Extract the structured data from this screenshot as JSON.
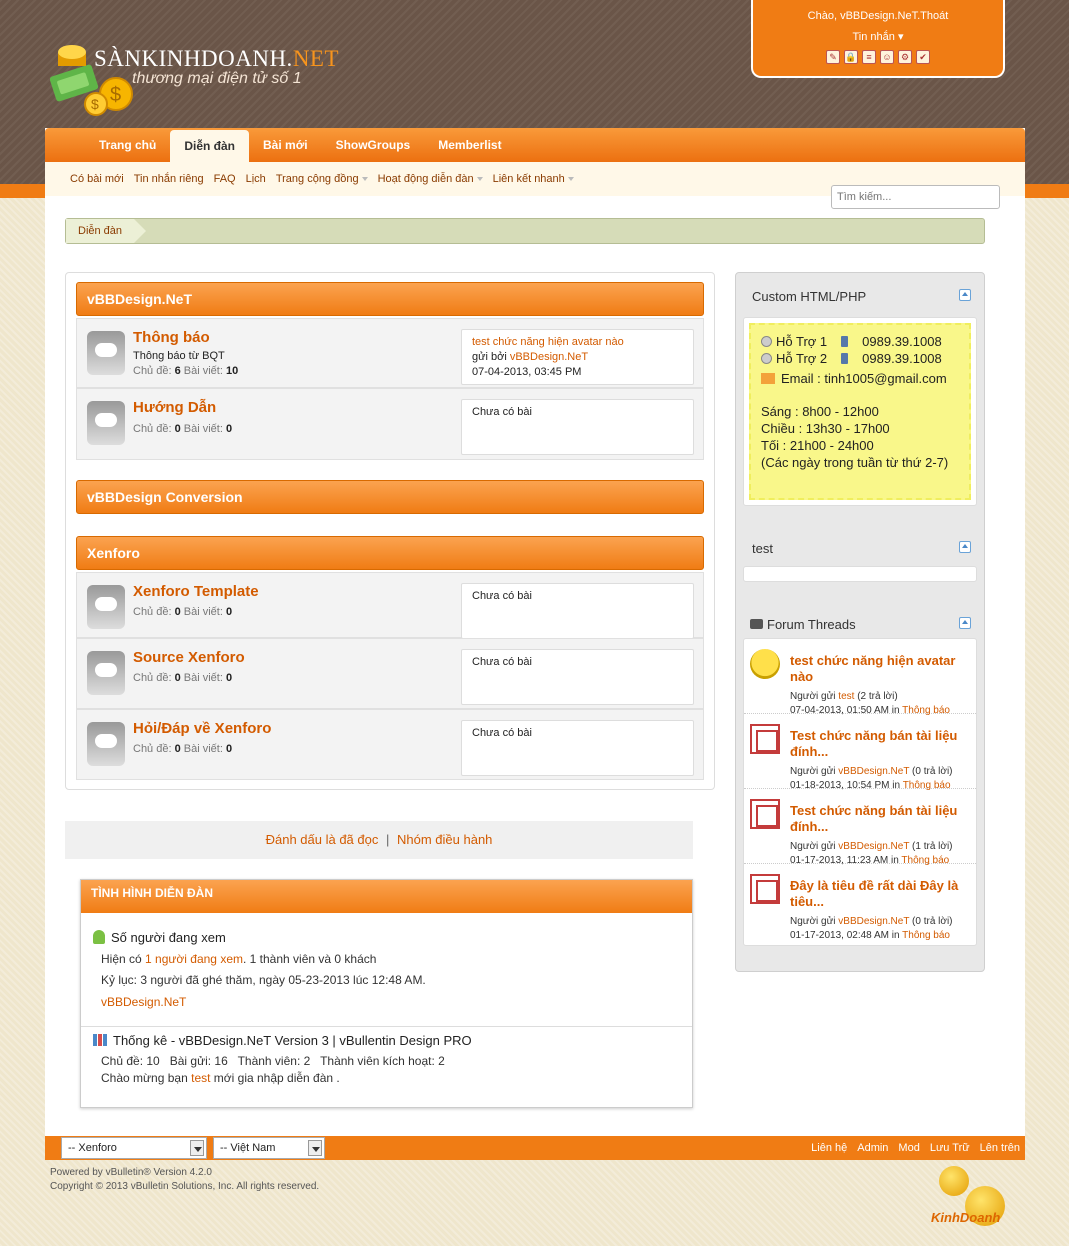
{
  "header": {
    "logo_title_main": "SÀNKINHDOANH.",
    "logo_title_net": "NET",
    "logo_slogan": "thương mại điện tử số 1",
    "greeting": "Chào, vBBDesign.NeT.Thoát",
    "private_messages": "Tin nhắn",
    "icon_names": [
      "edit-icon",
      "lock-icon",
      "document-icon",
      "users-icon",
      "settings-icon",
      "tools-icon"
    ]
  },
  "navbar": {
    "tabs": [
      "Trang chủ",
      "Diễn đàn",
      "Bài mới",
      "ShowGroups",
      "Memberlist"
    ],
    "active_tab": "Diễn đàn"
  },
  "subnav": [
    "Có bài mới",
    "Tin nhắn riêng",
    "FAQ",
    "Lịch",
    "Trang cộng đồng",
    "Hoạt động diễn đàn",
    "Liên kết nhanh"
  ],
  "search": {
    "placeholder": "Tìm kiếm..."
  },
  "breadcrumb": "Diễn đàn",
  "categories": [
    {
      "name": "vBBDesign.NeT",
      "forums": [
        {
          "name": "Thông báo",
          "desc": "Thông báo từ BQT",
          "stats_label_topics": "Chủ đề:",
          "topics": "6",
          "stats_label_posts": "Bài viết:",
          "posts": "10",
          "last_title": "test chức năng hiện avatar nào",
          "last_by_label": "gửi bởi",
          "last_by": "vBBDesign.NeT",
          "last_date": "07-04-2013, 03:45 PM"
        },
        {
          "name": "Hướng Dẫn",
          "desc": "",
          "stats_label_topics": "Chủ đề:",
          "topics": "0",
          "stats_label_posts": "Bài viết:",
          "posts": "0",
          "empty": "Chưa có bài"
        }
      ]
    },
    {
      "name": "vBBDesign Conversion",
      "forums": []
    },
    {
      "name": "Xenforo",
      "forums": [
        {
          "name": "Xenforo Template",
          "stats_label_topics": "Chủ đề:",
          "topics": "0",
          "stats_label_posts": "Bài viết:",
          "posts": "0",
          "empty": "Chưa có bài"
        },
        {
          "name": "Source Xenforo",
          "stats_label_topics": "Chủ đề:",
          "topics": "0",
          "stats_label_posts": "Bài viết:",
          "posts": "0",
          "empty": "Chưa có bài"
        },
        {
          "name": "Hỏi/Đáp về Xenforo",
          "stats_label_topics": "Chủ đề:",
          "topics": "0",
          "stats_label_posts": "Bài viết:",
          "posts": "0",
          "empty": "Chưa có bài"
        }
      ]
    }
  ],
  "sidebar": {
    "custom_title": "Custom HTML/PHP",
    "support": {
      "sup1": "Hỗ Trợ 1",
      "phone1": "0989.39.1008",
      "sup2": "Hỗ Trợ 2",
      "phone2": "0989.39.1008",
      "email": "Email : tinh1005@gmail.com",
      "hours": [
        "Sáng : 8h00 - 12h00",
        "Chiều : 13h30 - 17h00",
        "Tối : 21h00 - 24h00",
        "(Các ngày trong tuần từ thứ 2-7)"
      ]
    },
    "test_title": "test",
    "threads_title": "Forum Threads",
    "threads": [
      {
        "title": "test chức năng hiện avatar nào",
        "by_label": "Người gửi",
        "by": "test",
        "replies": "(2 trả lời)",
        "date": "07-04-2013, 01:50 AM",
        "in": "in",
        "forum": "Thông báo",
        "avatar": "smile"
      },
      {
        "title": "Test chức năng bán tài liệu đính...",
        "by_label": "Người gửi",
        "by": "vBBDesign.NeT",
        "replies": "(0 trả lời)",
        "date": "01-18-2013, 10:54 PM",
        "in": "in",
        "forum": "Thông báo",
        "avatar": "seal"
      },
      {
        "title": "Test chức năng bán tài liệu đính...",
        "by_label": "Người gửi",
        "by": "vBBDesign.NeT",
        "replies": "(1 trả lời)",
        "date": "01-17-2013, 11:23 AM",
        "in": "in",
        "forum": "Thông báo",
        "avatar": "seal"
      },
      {
        "title": "Đây là tiêu đề rất dài Đây là tiêu...",
        "by_label": "Người gửi",
        "by": "vBBDesign.NeT",
        "replies": "(0 trả lời)",
        "date": "01-17-2013, 02:48 AM",
        "in": "in",
        "forum": "Thông báo",
        "avatar": "seal"
      }
    ]
  },
  "footer_links": {
    "mark_read": "Đánh dấu là đã đọc",
    "separator": "|",
    "moderators": "Nhóm điều hành"
  },
  "status": {
    "title": "Tình hình diễn đàn",
    "online_title": "Số người đang xem",
    "online_pre": "Hiện có",
    "online_link": "1 người đang xem",
    "online_post": ". 1 thành viên và 0 khách",
    "record": "Kỷ lục: 3 người đã ghé thăm, ngày 05-23-2013 lúc 12:48 AM.",
    "online_user": "vBBDesign.NeT",
    "stats_title": "Thống kê - vBBDesign.NeT Version 3 | vBullentin Design PRO",
    "stats_line": "Chủ đề: 10   Bài gửi: 16   Thành viên: 2   Thành viên kích hoạt: 2",
    "welcome_pre": "Chào mừng bạn",
    "welcome_user": "test",
    "welcome_post": "mới gia nhập diễn đàn ."
  },
  "bottom": {
    "style_select": "-- Xenforo",
    "lang_select": "-- Việt Nam",
    "links": [
      "Liên hệ",
      "Admin",
      "Mod",
      "Lưu Trữ",
      "Lên trên"
    ],
    "powered": "Powered by vBulletin® Version 4.2.0",
    "copyright": "Copyright © 2013 vBulletin Solutions, Inc. All rights reserved.",
    "footer_logo_text": "KinhDoanh"
  },
  "colors": {
    "accent": "#f07c14",
    "link": "#d35b00",
    "header_bg": "#6a5548",
    "support_bg": "#f9f78a"
  }
}
